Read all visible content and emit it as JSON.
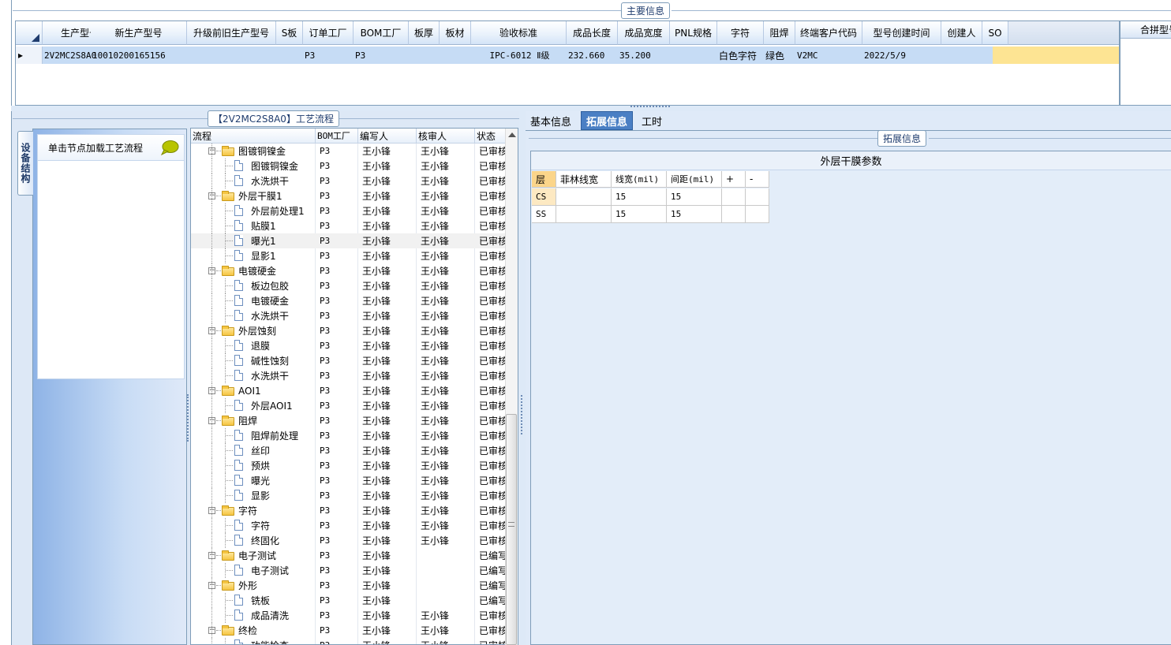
{
  "main_info": {
    "legend": "主要信息",
    "columns": [
      "生产型号",
      "新生产型号",
      "升级前旧生产型号",
      "S板",
      "订单工厂",
      "BOM工厂",
      "板厚",
      "板材",
      "验收标准",
      "成品长度",
      "成品宽度",
      "PNL规格",
      "字符",
      "阻焊",
      "终端客户代码",
      "型号创建时间",
      "创建人",
      "SO"
    ],
    "row": [
      "2V2MC2S8A0",
      "10010200165156",
      "",
      "",
      "P3",
      "P3",
      "",
      "",
      "IPC-6012 Ⅱ级",
      "232.660",
      "35.200",
      "",
      "白色字符",
      "绿色",
      "V2MC",
      "2022/5/9",
      "",
      ""
    ],
    "row_indicator": "▸",
    "right_header": "合拼型号"
  },
  "process": {
    "legend": "【2V2MC2S8A0】工艺流程",
    "side_tab": "设备结构",
    "side_header": "单击节点加载工艺流程",
    "columns": [
      "流程",
      "BOM工厂",
      "编写人",
      "核审人",
      "状态"
    ],
    "rows": [
      {
        "level": 0,
        "name": "图镀铜镍金",
        "bom": "P3",
        "writer": "王小锋",
        "reviewer": "王小锋",
        "status": "已审核"
      },
      {
        "level": 1,
        "name": "图镀铜镍金",
        "bom": "P3",
        "writer": "王小锋",
        "reviewer": "王小锋",
        "status": "已审核"
      },
      {
        "level": 1,
        "name": "水洗烘干",
        "bom": "P3",
        "writer": "王小锋",
        "reviewer": "王小锋",
        "status": "已审核"
      },
      {
        "level": 0,
        "name": "外层干膜1",
        "bom": "P3",
        "writer": "王小锋",
        "reviewer": "王小锋",
        "status": "已审核"
      },
      {
        "level": 1,
        "name": "外层前处理1",
        "bom": "P3",
        "writer": "王小锋",
        "reviewer": "王小锋",
        "status": "已审核"
      },
      {
        "level": 1,
        "name": "贴膜1",
        "bom": "P3",
        "writer": "王小锋",
        "reviewer": "王小锋",
        "status": "已审核"
      },
      {
        "level": 1,
        "name": "曝光1",
        "bom": "P3",
        "writer": "王小锋",
        "reviewer": "王小锋",
        "status": "已审核",
        "selected": true
      },
      {
        "level": 1,
        "name": "显影1",
        "bom": "P3",
        "writer": "王小锋",
        "reviewer": "王小锋",
        "status": "已审核"
      },
      {
        "level": 0,
        "name": "电镀硬金",
        "bom": "P3",
        "writer": "王小锋",
        "reviewer": "王小锋",
        "status": "已审核"
      },
      {
        "level": 1,
        "name": "板边包胶",
        "bom": "P3",
        "writer": "王小锋",
        "reviewer": "王小锋",
        "status": "已审核"
      },
      {
        "level": 1,
        "name": "电镀硬金",
        "bom": "P3",
        "writer": "王小锋",
        "reviewer": "王小锋",
        "status": "已审核"
      },
      {
        "level": 1,
        "name": "水洗烘干",
        "bom": "P3",
        "writer": "王小锋",
        "reviewer": "王小锋",
        "status": "已审核"
      },
      {
        "level": 0,
        "name": "外层蚀刻",
        "bom": "P3",
        "writer": "王小锋",
        "reviewer": "王小锋",
        "status": "已审核"
      },
      {
        "level": 1,
        "name": "退膜",
        "bom": "P3",
        "writer": "王小锋",
        "reviewer": "王小锋",
        "status": "已审核"
      },
      {
        "level": 1,
        "name": "碱性蚀刻",
        "bom": "P3",
        "writer": "王小锋",
        "reviewer": "王小锋",
        "status": "已审核"
      },
      {
        "level": 1,
        "name": "水洗烘干",
        "bom": "P3",
        "writer": "王小锋",
        "reviewer": "王小锋",
        "status": "已审核"
      },
      {
        "level": 0,
        "name": "AOI1",
        "bom": "P3",
        "writer": "王小锋",
        "reviewer": "王小锋",
        "status": "已审核"
      },
      {
        "level": 1,
        "name": "外层AOI1",
        "bom": "P3",
        "writer": "王小锋",
        "reviewer": "王小锋",
        "status": "已审核"
      },
      {
        "level": 0,
        "name": "阻焊",
        "bom": "P3",
        "writer": "王小锋",
        "reviewer": "王小锋",
        "status": "已审核"
      },
      {
        "level": 1,
        "name": "阻焊前处理",
        "bom": "P3",
        "writer": "王小锋",
        "reviewer": "王小锋",
        "status": "已审核"
      },
      {
        "level": 1,
        "name": "丝印",
        "bom": "P3",
        "writer": "王小锋",
        "reviewer": "王小锋",
        "status": "已审核"
      },
      {
        "level": 1,
        "name": "预烘",
        "bom": "P3",
        "writer": "王小锋",
        "reviewer": "王小锋",
        "status": "已审核"
      },
      {
        "level": 1,
        "name": "曝光",
        "bom": "P3",
        "writer": "王小锋",
        "reviewer": "王小锋",
        "status": "已审核"
      },
      {
        "level": 1,
        "name": "显影",
        "bom": "P3",
        "writer": "王小锋",
        "reviewer": "王小锋",
        "status": "已审核"
      },
      {
        "level": 0,
        "name": "字符",
        "bom": "P3",
        "writer": "王小锋",
        "reviewer": "王小锋",
        "status": "已审核"
      },
      {
        "level": 1,
        "name": "字符",
        "bom": "P3",
        "writer": "王小锋",
        "reviewer": "王小锋",
        "status": "已审核"
      },
      {
        "level": 1,
        "name": "终固化",
        "bom": "P3",
        "writer": "王小锋",
        "reviewer": "王小锋",
        "status": "已审核"
      },
      {
        "level": 0,
        "name": "电子测试",
        "bom": "P3",
        "writer": "王小锋",
        "reviewer": "",
        "status": "已编写"
      },
      {
        "level": 1,
        "name": "电子测试",
        "bom": "P3",
        "writer": "王小锋",
        "reviewer": "",
        "status": "已编写"
      },
      {
        "level": 0,
        "name": "外形",
        "bom": "P3",
        "writer": "王小锋",
        "reviewer": "",
        "status": "已编写"
      },
      {
        "level": 1,
        "name": "铣板",
        "bom": "P3",
        "writer": "王小锋",
        "reviewer": "",
        "status": "已编写"
      },
      {
        "level": 1,
        "name": "成品清洗",
        "bom": "P3",
        "writer": "王小锋",
        "reviewer": "王小锋",
        "status": "已审核"
      },
      {
        "level": 0,
        "name": "终检",
        "bom": "P3",
        "writer": "王小锋",
        "reviewer": "王小锋",
        "status": "已审核"
      },
      {
        "level": 1,
        "name": "功能检查",
        "bom": "P3",
        "writer": "王小锋",
        "reviewer": "王小锋",
        "status": "已审核"
      }
    ]
  },
  "detail": {
    "tabs": [
      "基本信息",
      "拓展信息",
      "工时"
    ],
    "active_tab": 1,
    "legend": "拓展信息",
    "table_title": "外层干膜参数",
    "columns": [
      "层",
      "菲林线宽",
      "线宽(mil)",
      "间距(mil)",
      "+",
      "-"
    ],
    "rows": [
      [
        "CS",
        "",
        "15",
        "15",
        "",
        ""
      ],
      [
        "SS",
        "",
        "15",
        "15",
        "",
        ""
      ]
    ]
  },
  "colors": {
    "selection": "#c6dcf5",
    "highlight": "#fde493",
    "active_tab": "#4a7fc4"
  }
}
